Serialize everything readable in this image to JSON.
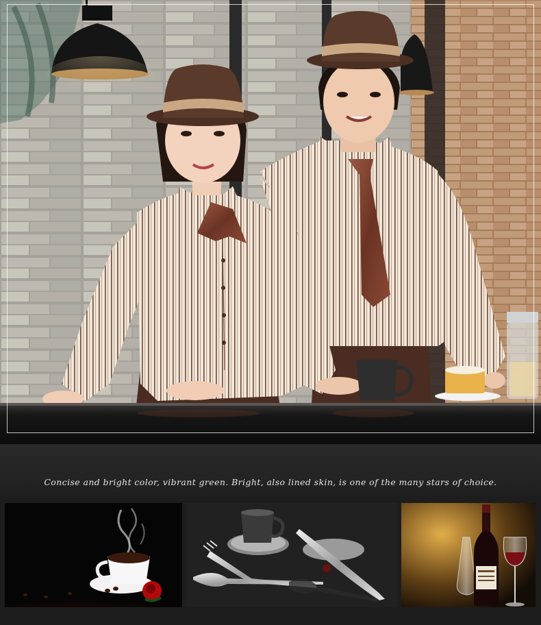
{
  "caption": "Concise and bright color, vibrant green. Bright, also lined skin, is one of the many stars of choice.",
  "colors": {
    "brick": "#b88f6c",
    "shirt_base": "#f2e8da",
    "stripe": "#6e4a3a",
    "tie": "#7a3f2c",
    "hat": "#5a3a2a",
    "apron": "#4a2c22",
    "counter": "#1a1a1a",
    "band": "#262626"
  },
  "icons": {
    "hero": "staff-uniform-photo",
    "coffee": "coffee-cup-with-rose",
    "cutlery": "cutlery-set",
    "wine": "wine-bottle-and-glass"
  }
}
